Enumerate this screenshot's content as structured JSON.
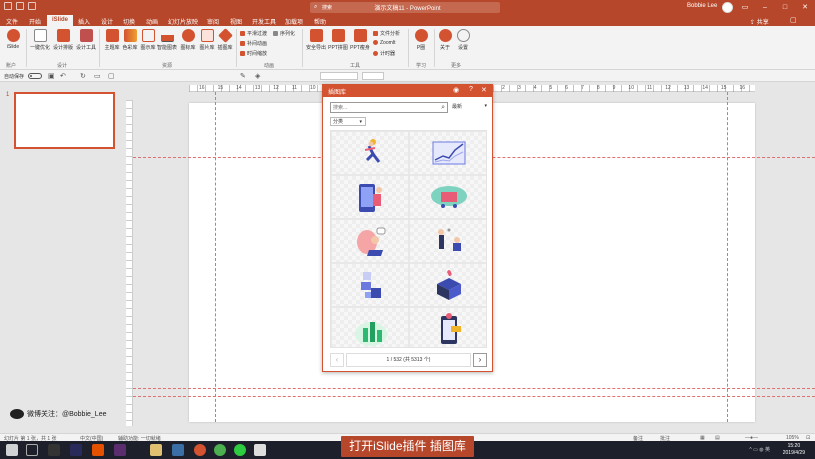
{
  "window": {
    "title": "演示文稿11 - PowerPoint",
    "user_name": "Bobbie Lee",
    "search_placeholder": "搜索"
  },
  "ribbon_tabs": [
    "文件",
    "开始",
    "iSlide",
    "插入",
    "设计",
    "切换",
    "动画",
    "幻灯片放映",
    "审阅",
    "视图",
    "开发工具",
    "加载项",
    "帮助"
  ],
  "ribbon_tabs_active": "iSlide",
  "share_label": "共享",
  "ribbon": {
    "account": {
      "label": "iSlide",
      "group": "账户"
    },
    "design": {
      "buttons": [
        "一键优化",
        "设计排版",
        "设计工具"
      ],
      "group": "设计"
    },
    "resources": {
      "buttons": [
        "主题库",
        "色彩库",
        "图示库",
        "智能图表",
        "图标库",
        "图片库",
        "插图库"
      ],
      "group": "资源"
    },
    "animation": {
      "items": [
        "平滑过渡",
        "序列化",
        "补间动画",
        "时间缩放"
      ],
      "group": "动画"
    },
    "tools": {
      "buttons": [
        "安全导出",
        "PPT拼图",
        "PPT瘦身"
      ],
      "items": [
        "文件分析",
        "ZoomIt",
        "计时器"
      ],
      "group": "工具"
    },
    "learn": {
      "label": "P圈",
      "group": "学习"
    },
    "more": {
      "buttons": [
        "关于",
        "设置"
      ],
      "group": "更多"
    }
  },
  "format_bar": {
    "autosave": "自动保存"
  },
  "slides": {
    "current_number": "1"
  },
  "ruler_numbers": [
    "16",
    "15",
    "14",
    "13",
    "12",
    "11",
    "10",
    "9",
    "8",
    "7",
    "6",
    "5",
    "4",
    "3",
    "2",
    "1",
    "0",
    "1",
    "2",
    "3",
    "4",
    "5",
    "6",
    "7",
    "8",
    "9",
    "10",
    "11",
    "12",
    "13",
    "14",
    "15",
    "16"
  ],
  "panel": {
    "title": "插图库",
    "search_placeholder": "搜索...",
    "sort_label": "最新",
    "filter_label": "分类",
    "pager_text": "1 / 532 (共 5313 个)",
    "accent": "#d35230"
  },
  "illustrations": [
    "person-running-with-trophy",
    "growth-line-chart",
    "shopping-phone-with-bag",
    "online-shopping-cart",
    "person-with-speech-bubble",
    "two-people-conversation",
    "stacked-boxes-delivery",
    "gift-box-opening",
    "green-bar-chart-plants",
    "mobile-payment-phone"
  ],
  "watermark": "微博关注：@Bobbie_Lee",
  "status": {
    "slide_info": "幻灯片 第 1 张，共 1 张",
    "language": "中文(中国)",
    "accessibility": "辅助功能: 一切就绪",
    "notes": "备注",
    "comments": "批注",
    "zoom": "105%"
  },
  "caption": "打开iSlide插件 插图库",
  "taskbar": {
    "time": "15:20",
    "date": "2019/4/29"
  },
  "colors": {
    "brand": "#b7472a",
    "accent": "#d35230"
  }
}
